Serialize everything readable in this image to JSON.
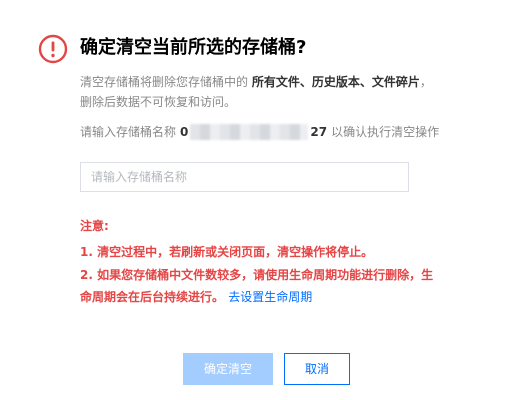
{
  "dialog": {
    "title": "确定清空当前所选的存储桶?",
    "description_prefix": "清空存储桶将删除您存储桶中的 ",
    "description_bold": "所有文件、历史版本、文件碎片",
    "description_suffix": "，删除后数据不可恢复和访问。",
    "confirm_prefix": "请输入存储桶名称",
    "bucket_name_start": "0",
    "bucket_name_end": "27",
    "confirm_suffix": "以确认执行清空操作",
    "input": {
      "placeholder": "请输入存储桶名称",
      "value": ""
    },
    "notice": {
      "heading": "注意:",
      "item1": "1. 清空过程中，若刷新或关闭页面，清空操作将停止。",
      "item2": "2. 如果您存储桶中文件数较多，请使用生命周期功能进行删除，生命周期会在后台持续进行。",
      "link": "去设置生命周期"
    },
    "buttons": {
      "confirm": "确定清空",
      "cancel": "取消"
    },
    "colors": {
      "warning": "#e54545",
      "primary_disabled": "#a3ccff",
      "link": "#006eff"
    },
    "icon": "exclamation-circle-icon"
  }
}
